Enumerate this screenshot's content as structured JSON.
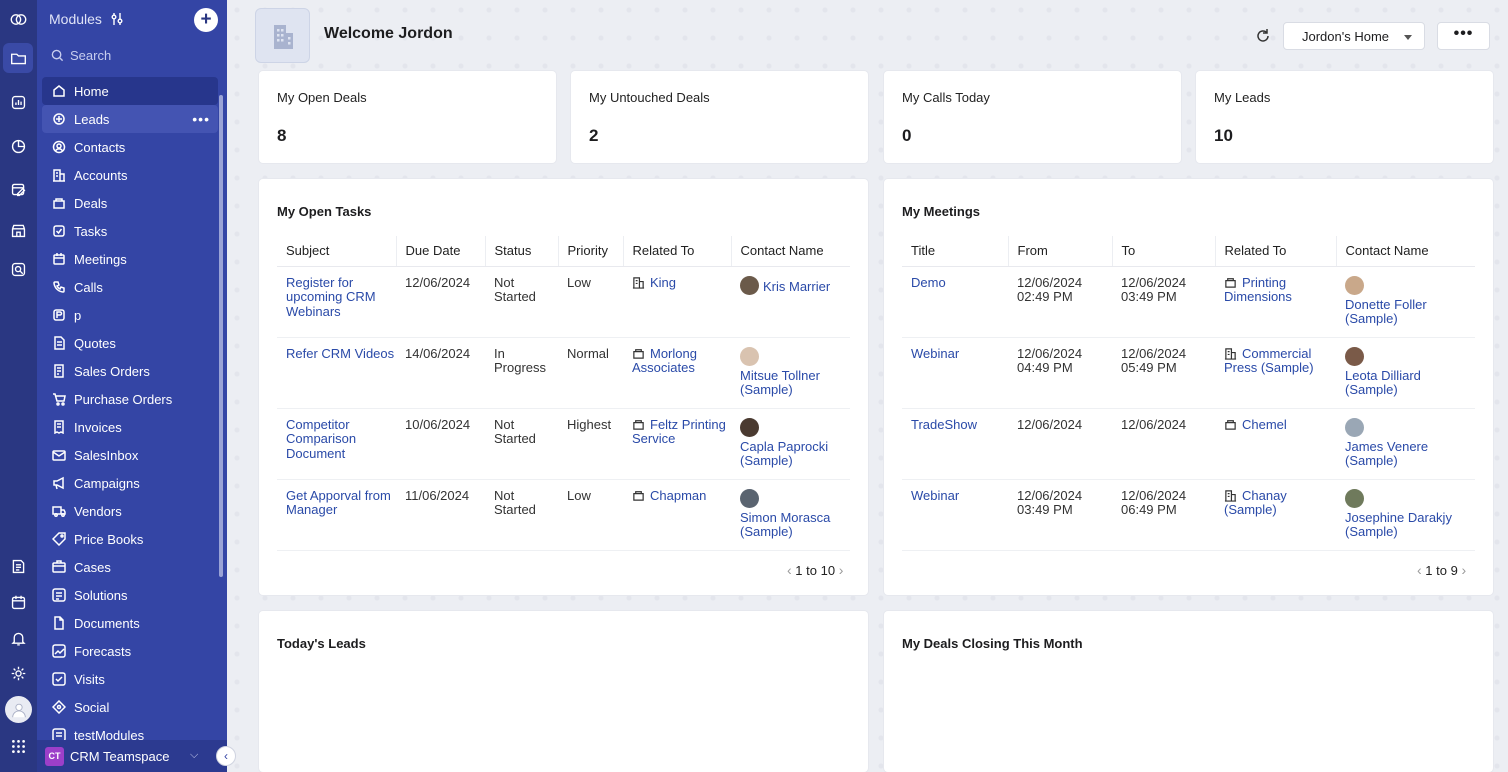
{
  "modules": {
    "title": "Modules",
    "search_placeholder": "Search",
    "items": [
      {
        "label": "Home"
      },
      {
        "label": "Leads"
      },
      {
        "label": "Contacts"
      },
      {
        "label": "Accounts"
      },
      {
        "label": "Deals"
      },
      {
        "label": "Tasks"
      },
      {
        "label": "Meetings"
      },
      {
        "label": "Calls"
      },
      {
        "label": "p"
      },
      {
        "label": "Quotes"
      },
      {
        "label": "Sales Orders"
      },
      {
        "label": "Purchase Orders"
      },
      {
        "label": "Invoices"
      },
      {
        "label": "SalesInbox"
      },
      {
        "label": "Campaigns"
      },
      {
        "label": "Vendors"
      },
      {
        "label": "Price Books"
      },
      {
        "label": "Cases"
      },
      {
        "label": "Solutions"
      },
      {
        "label": "Documents"
      },
      {
        "label": "Forecasts"
      },
      {
        "label": "Visits"
      },
      {
        "label": "Social"
      },
      {
        "label": "testModules"
      }
    ],
    "teamspace_badge": "CT",
    "teamspace_label": "CRM Teamspace",
    "more_glyph": "•••"
  },
  "header": {
    "welcome": "Welcome Jordon",
    "home_select": "Jordon's Home",
    "more_glyph": "•••"
  },
  "stats": [
    {
      "label": "My Open Deals",
      "value": "8"
    },
    {
      "label": "My Untouched Deals",
      "value": "2"
    },
    {
      "label": "My Calls Today",
      "value": "0"
    },
    {
      "label": "My Leads",
      "value": "10"
    }
  ],
  "tasks": {
    "title": "My Open Tasks",
    "columns": [
      "Subject",
      "Due Date",
      "Status",
      "Priority",
      "Related To",
      "Contact Name"
    ],
    "rows": [
      {
        "subject": "Register for upcoming CRM Webinars",
        "due": "12/06/2024",
        "status": "Not Started",
        "priority": "Low",
        "related": "King",
        "related_icon": "account-icon",
        "contact": "Kris Marrier"
      },
      {
        "subject": "Refer CRM Videos",
        "due": "14/06/2024",
        "status": "In Progress",
        "priority": "Normal",
        "related": "Morlong Associates",
        "related_icon": "deal-icon",
        "contact": "Mitsue Tollner (Sample)"
      },
      {
        "subject": "Competitor Comparison Document",
        "due": "10/06/2024",
        "status": "Not Started",
        "priority": "Highest",
        "related": "Feltz Printing Service",
        "related_icon": "deal-icon",
        "contact": "Capla Paprocki (Sample)"
      },
      {
        "subject": "Get Apporval from Manager",
        "due": "11/06/2024",
        "status": "Not Started",
        "priority": "Low",
        "related": "Chapman",
        "related_icon": "deal-icon",
        "contact": "Simon Morasca (Sample)"
      }
    ],
    "pager_from": "1",
    "pager_to": "to",
    "pager_total": "10"
  },
  "meetings": {
    "title": "My Meetings",
    "columns": [
      "Title",
      "From",
      "To",
      "Related To",
      "Contact Name"
    ],
    "rows": [
      {
        "title": "Demo",
        "from": "12/06/2024 02:49 PM",
        "to": "12/06/2024 03:49 PM",
        "related": "Printing Dimensions",
        "related_icon": "deal-icon",
        "contact": "Donette Foller (Sample)"
      },
      {
        "title": "Webinar",
        "from": "12/06/2024 04:49 PM",
        "to": "12/06/2024 05:49 PM",
        "related": "Commercial Press (Sample)",
        "related_icon": "account-icon",
        "contact": "Leota Dilliard (Sample)"
      },
      {
        "title": "TradeShow",
        "from": "12/06/2024",
        "to": "12/06/2024",
        "related": "Chemel",
        "related_icon": "deal-icon",
        "contact": "James Venere (Sample)"
      },
      {
        "title": "Webinar",
        "from": "12/06/2024 03:49 PM",
        "to": "12/06/2024 06:49 PM",
        "related": "Chanay (Sample)",
        "related_icon": "account-icon",
        "contact": "Josephine Darakjy (Sample)"
      }
    ],
    "pager_from": "1",
    "pager_to": "to",
    "pager_total": "9"
  },
  "todays_leads": {
    "title": "Today's Leads"
  },
  "deals_closing": {
    "title": "My Deals Closing This Month"
  },
  "colors": {
    "rail": "#2a3782",
    "sidebar": "#3445a5",
    "link": "#2a4aa8"
  }
}
